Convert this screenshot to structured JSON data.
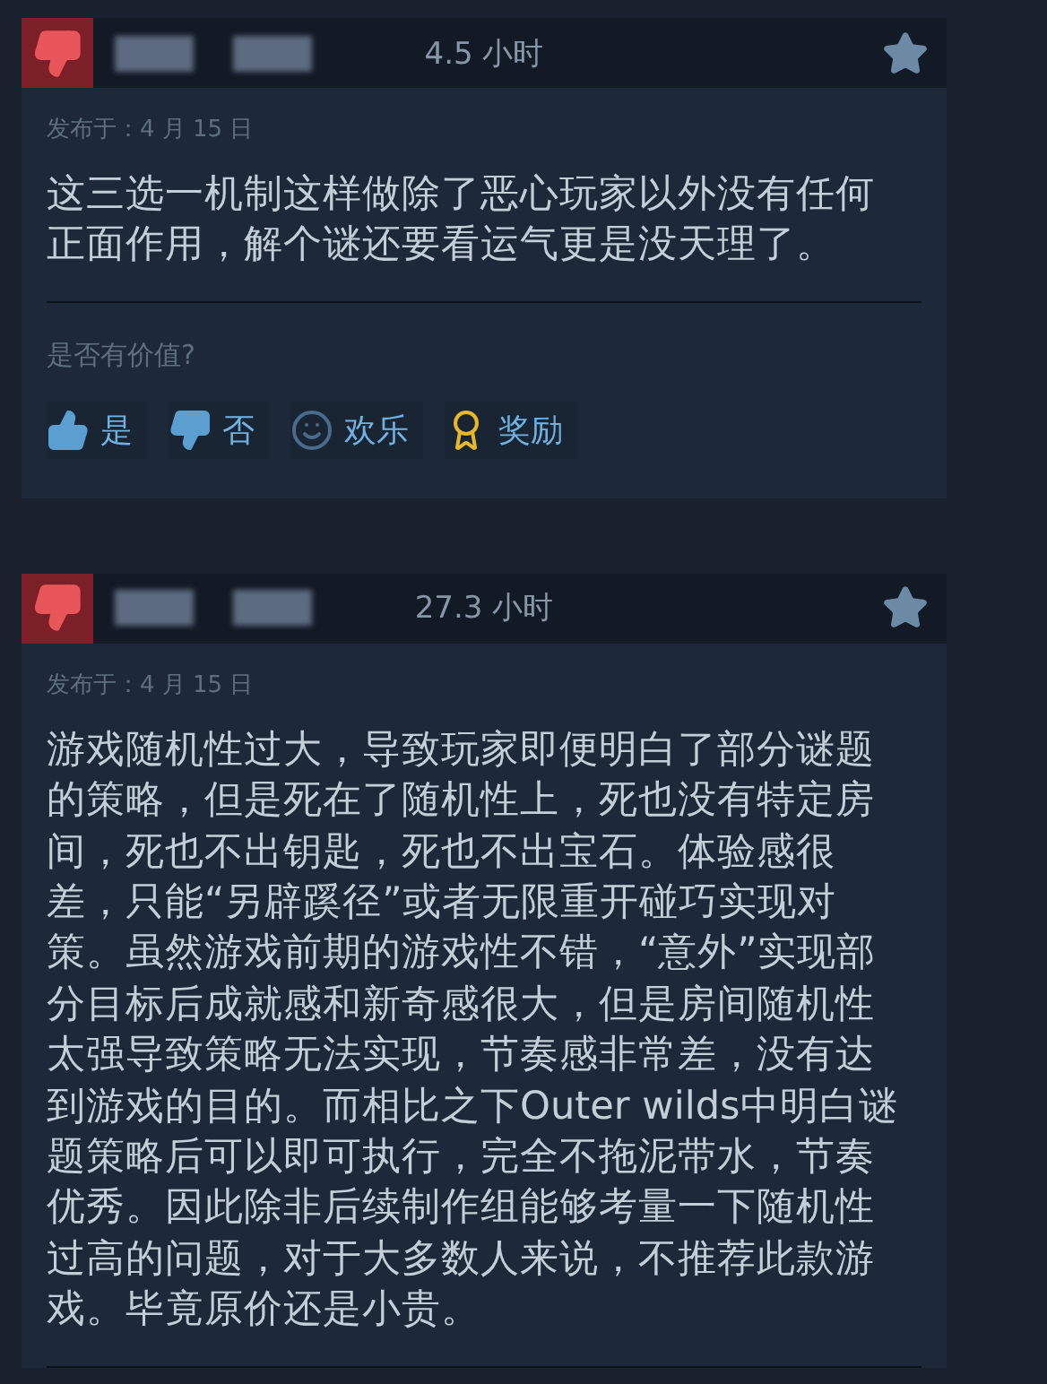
{
  "reviews": [
    {
      "recommended": false,
      "hours": "4.5 小时",
      "posted": "发布于：4 月 15 日",
      "text": "这三选一机制这样做除了恶心玩家以外没有任何正面作用，解个谜还要看运气更是没天理了。",
      "helpful_prompt": "是否有价值?",
      "actions": [
        {
          "kind": "yes",
          "label": "是"
        },
        {
          "kind": "no",
          "label": "否"
        },
        {
          "kind": "funny",
          "label": "欢乐"
        },
        {
          "kind": "award",
          "label": "奖励"
        }
      ]
    },
    {
      "recommended": false,
      "hours": "27.3 小时",
      "posted": "发布于：4 月 15 日",
      "text": "游戏随机性过大，导致玩家即便明白了部分谜题的策略，但是死在了随机性上，死也没有特定房间，死也不出钥匙，死也不出宝石。体验感很差，只能“另辟蹊径”或者无限重开碰巧实现对策。虽然游戏前期的游戏性不错，“意外”实现部分目标后成就感和新奇感很大，但是房间随机性太强导致策略无法实现，节奏感非常差，没有达到游戏的目的。而相比之下Outer wilds中明白谜题策略后可以即可执行，完全不拖泥带水，节奏优秀。因此除非后续制作组能够考量一下随机性过高的问题，对于大多数人来说，不推荐此款游戏。毕竟原价还是小贵。"
    }
  ]
}
